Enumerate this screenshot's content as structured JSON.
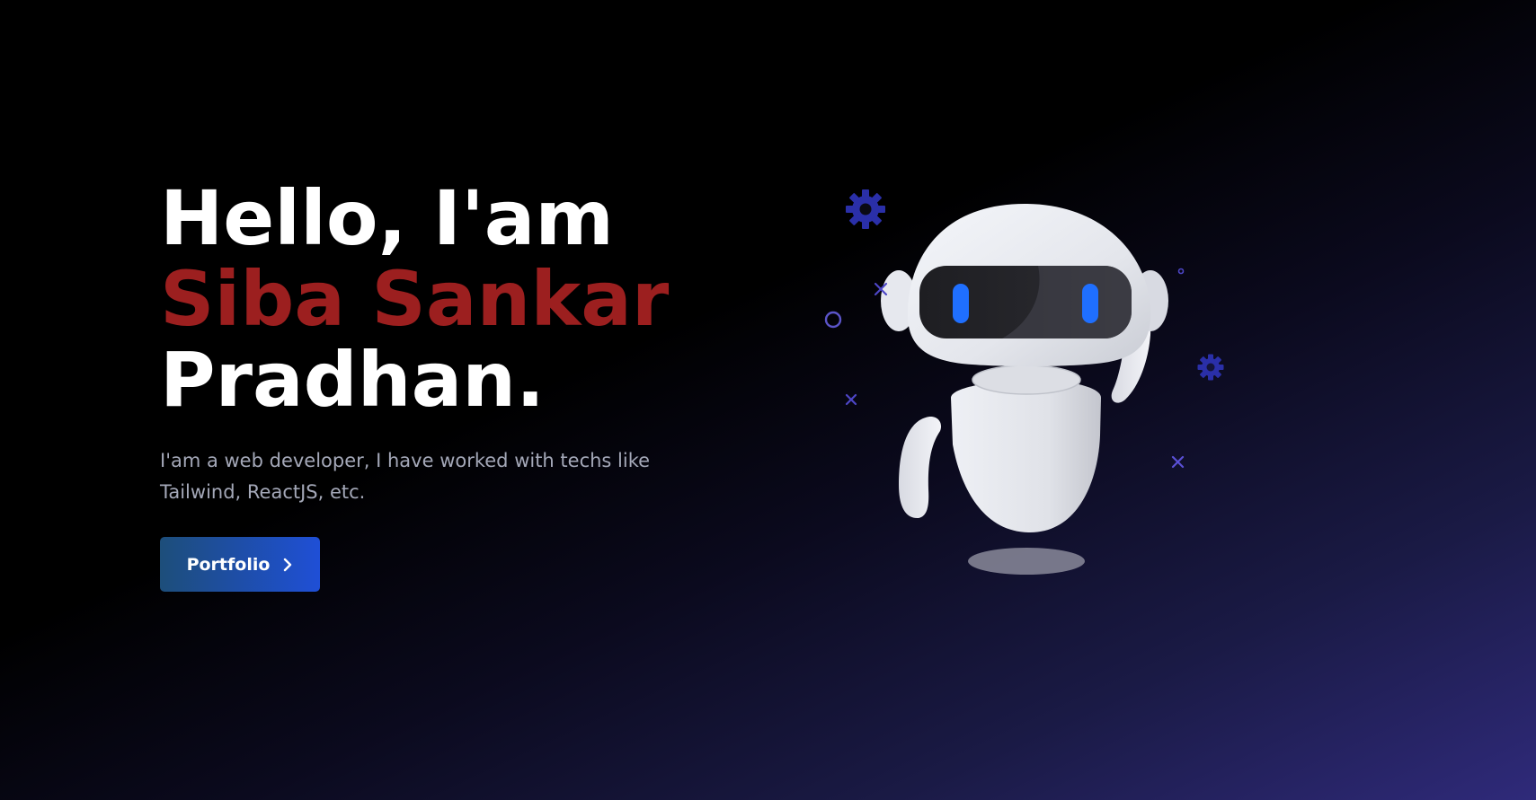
{
  "hero": {
    "greeting": "Hello, I'am",
    "name": "Siba Sankar",
    "surname": "Pradhan.",
    "description": "I'am a web developer, I have worked with techs like Tailwind, ReactJS, etc.",
    "cta_label": "Portfolio"
  },
  "colors": {
    "name_accent": "#9c1f1f",
    "button_gradient_start": "#1d4e7a",
    "button_gradient_end": "#1f4fd6",
    "background_start": "#000000",
    "background_end": "#2f2a7a",
    "robot_eyes": "#1f6fff"
  },
  "icons": {
    "cta": "chevron-right-icon",
    "decorations": [
      "gear-icon",
      "cross-icon",
      "circle-icon",
      "dot-icon"
    ]
  }
}
